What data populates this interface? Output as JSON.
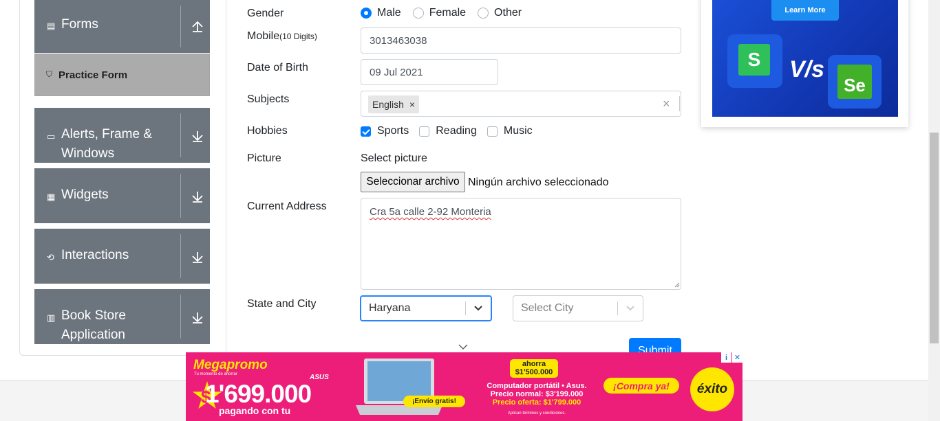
{
  "sidebar": {
    "groups": [
      {
        "label": "Forms",
        "icon": "document-icon",
        "arrow": "arrow-up"
      },
      {
        "label_line1": "Alerts, Frame &",
        "label_line2": "Windows",
        "icon": "window-icon",
        "arrow": "arrow-down"
      },
      {
        "label": "Widgets",
        "icon": "widgets-icon",
        "arrow": "arrow-down"
      },
      {
        "label": "Interactions",
        "icon": "interactions-icon",
        "arrow": "arrow-down"
      },
      {
        "label_line1": "Book Store",
        "label_line2": "Application",
        "icon": "books-icon",
        "arrow": "arrow-down"
      }
    ],
    "active_item": {
      "label": "Practice Form",
      "icon": "html5-icon"
    }
  },
  "form": {
    "gender": {
      "label": "Gender",
      "options": [
        "Male",
        "Female",
        "Other"
      ],
      "selected": "Male"
    },
    "mobile": {
      "label": "Mobile",
      "hint": "(10 Digits)",
      "value": "3013463038"
    },
    "dob": {
      "label": "Date of Birth",
      "value": "09 Jul 2021"
    },
    "subjects": {
      "label": "Subjects",
      "chips": [
        "English"
      ],
      "chip_remove": "×",
      "clear": "×"
    },
    "hobbies": {
      "label": "Hobbies",
      "options": [
        "Sports",
        "Reading",
        "Music"
      ],
      "checked": [
        "Sports"
      ]
    },
    "picture": {
      "label": "Picture",
      "prompt": "Select picture",
      "button": "Seleccionar archivo",
      "status": "Ningún archivo seleccionado"
    },
    "address": {
      "label": "Current Address",
      "value": "Cra 5a calle 2-92 Monteria"
    },
    "state_city": {
      "label": "State and City",
      "state_value": "Haryana",
      "city_placeholder": "Select City"
    },
    "submit": "Submit"
  },
  "ad_top": {
    "button": "Learn More",
    "vs_text": "V/s",
    "left_logo": "S",
    "right_logo": "Se"
  },
  "banner": {
    "title": "Megapromo",
    "subtitle": "Tu momento de ahorrar",
    "brand": "ASUS",
    "price_prefix": "$",
    "price": "1'699.000",
    "pay_text": "pagando con tu",
    "shipping": "¡Envío gratis!",
    "ahorra_line1": "ahorra",
    "ahorra_line2": "$1'500.000",
    "desc_line1": "Computador portátil • Asus.",
    "desc_line2": "Precio normal: $3'199.000",
    "desc_line3": "Precio oferta: $1'799.000",
    "terms": "Aplican términos y condiciones.",
    "cta": "¡Compra ya!",
    "logo": "éxito",
    "ad_info": "i",
    "ad_close": "✕"
  },
  "colors": {
    "sidebar_header": "#6c757d",
    "active_item": "#ababab",
    "primary": "#007bff",
    "banner_pink": "#ed1e79",
    "banner_yellow": "#ffe600"
  }
}
